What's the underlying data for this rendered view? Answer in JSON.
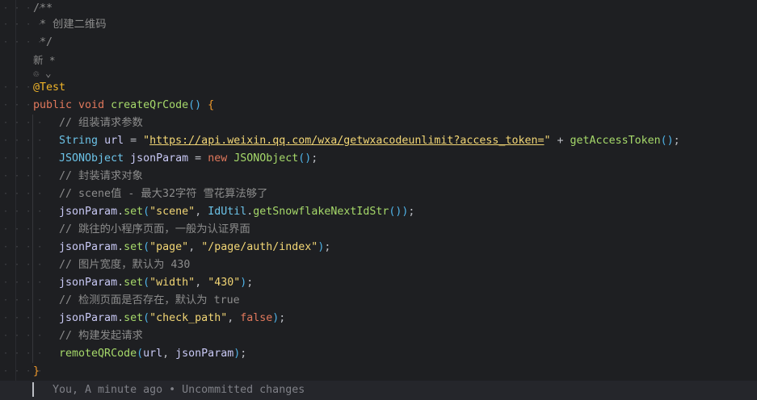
{
  "lines": [
    [
      {
        "t": "/**",
        "c": "cm"
      }
    ],
    [
      {
        "t": " * 创建二维码",
        "c": "cm"
      }
    ],
    [
      {
        "t": " */",
        "c": "cm"
      }
    ],
    [
      {
        "t": "新 *",
        "c": "hint"
      }
    ],
    [
      {
        "t": "♲ ⌄",
        "c": "hint"
      }
    ],
    [
      {
        "t": "@Test",
        "c": "an"
      }
    ],
    [
      {
        "t": "public ",
        "c": "kw"
      },
      {
        "t": "void ",
        "c": "kw"
      },
      {
        "t": "createQrCode",
        "c": "fn"
      },
      {
        "t": "()",
        "c": "pa"
      },
      {
        "t": " {",
        "c": "br"
      }
    ],
    [
      {
        "t": "    // 组装请求参数",
        "c": "cm"
      }
    ],
    [
      {
        "t": "    String ",
        "c": "ty"
      },
      {
        "t": "url",
        "c": "va"
      },
      {
        "t": " = ",
        "c": "pu"
      },
      {
        "t": "\"",
        "c": "st"
      },
      {
        "t": "https://api.weixin.qq.com/wxa/getwxacodeunlimit?access_token=",
        "c": "url"
      },
      {
        "t": "\"",
        "c": "st"
      },
      {
        "t": " + ",
        "c": "pu"
      },
      {
        "t": "getAccessToken",
        "c": "fn"
      },
      {
        "t": "()",
        "c": "pa"
      },
      {
        "t": ";",
        "c": "pu"
      }
    ],
    [
      {
        "t": "    JSONObject ",
        "c": "ty"
      },
      {
        "t": "jsonParam",
        "c": "va"
      },
      {
        "t": " = ",
        "c": "pu"
      },
      {
        "t": "new ",
        "c": "kw"
      },
      {
        "t": "JSONObject",
        "c": "fn"
      },
      {
        "t": "()",
        "c": "pa"
      },
      {
        "t": ";",
        "c": "pu"
      }
    ],
    [
      {
        "t": "    // 封装请求对象",
        "c": "cm"
      }
    ],
    [
      {
        "t": "    // scene值 - 最大32字符 雪花算法够了",
        "c": "cm"
      }
    ],
    [
      {
        "t": "    jsonParam",
        "c": "va"
      },
      {
        "t": ".",
        "c": "pu"
      },
      {
        "t": "set",
        "c": "fn"
      },
      {
        "t": "(",
        "c": "pa"
      },
      {
        "t": "\"scene\"",
        "c": "st"
      },
      {
        "t": ", ",
        "c": "pu"
      },
      {
        "t": "IdUtil",
        "c": "ty"
      },
      {
        "t": ".",
        "c": "pu"
      },
      {
        "t": "getSnowflakeNextIdStr",
        "c": "fn"
      },
      {
        "t": "())",
        "c": "pa"
      },
      {
        "t": ";",
        "c": "pu"
      }
    ],
    [
      {
        "t": "    // 跳往的小程序页面，一般为认证界面",
        "c": "cm"
      }
    ],
    [
      {
        "t": "    jsonParam",
        "c": "va"
      },
      {
        "t": ".",
        "c": "pu"
      },
      {
        "t": "set",
        "c": "fn"
      },
      {
        "t": "(",
        "c": "pa"
      },
      {
        "t": "\"page\"",
        "c": "st"
      },
      {
        "t": ", ",
        "c": "pu"
      },
      {
        "t": "\"/page/auth/index\"",
        "c": "st"
      },
      {
        "t": ")",
        "c": "pa"
      },
      {
        "t": ";",
        "c": "pu"
      }
    ],
    [
      {
        "t": "    // 图片宽度，默认为 430",
        "c": "cm"
      }
    ],
    [
      {
        "t": "    jsonParam",
        "c": "va"
      },
      {
        "t": ".",
        "c": "pu"
      },
      {
        "t": "set",
        "c": "fn"
      },
      {
        "t": "(",
        "c": "pa"
      },
      {
        "t": "\"width\"",
        "c": "st"
      },
      {
        "t": ", ",
        "c": "pu"
      },
      {
        "t": "\"430\"",
        "c": "st"
      },
      {
        "t": ")",
        "c": "pa"
      },
      {
        "t": ";",
        "c": "pu"
      }
    ],
    [
      {
        "t": "    // 检测页面是否存在，默认为 true",
        "c": "cm"
      }
    ],
    [
      {
        "t": "    jsonParam",
        "c": "va"
      },
      {
        "t": ".",
        "c": "pu"
      },
      {
        "t": "set",
        "c": "fn"
      },
      {
        "t": "(",
        "c": "pa"
      },
      {
        "t": "\"check_path\"",
        "c": "st"
      },
      {
        "t": ", ",
        "c": "pu"
      },
      {
        "t": "false",
        "c": "kw"
      },
      {
        "t": ")",
        "c": "pa"
      },
      {
        "t": ";",
        "c": "pu"
      }
    ],
    [
      {
        "t": "    // 构建发起请求",
        "c": "cm"
      }
    ],
    [
      {
        "t": "    remoteQRCode",
        "c": "fn"
      },
      {
        "t": "(",
        "c": "pa"
      },
      {
        "t": "url",
        "c": "va"
      },
      {
        "t": ", ",
        "c": "pu"
      },
      {
        "t": "jsonParam",
        "c": "va"
      },
      {
        "t": ")",
        "c": "pa"
      },
      {
        "t": ";",
        "c": "pu"
      }
    ],
    [
      {
        "t": "}",
        "c": "br"
      }
    ]
  ],
  "blame": "You, A minute ago • Uncommitted changes"
}
